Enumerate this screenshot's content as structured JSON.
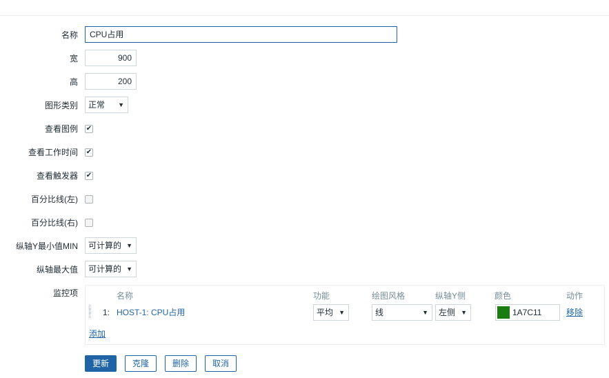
{
  "form": {
    "name_label": "名称",
    "name_value": "CPU占用",
    "width_label": "宽",
    "width_value": "900",
    "height_label": "高",
    "height_value": "200",
    "graph_type_label": "图形类别",
    "graph_type_value": "正常",
    "show_legend_label": "查看图例",
    "show_legend_checked": true,
    "show_work_period_label": "查看工作时间",
    "show_work_period_checked": true,
    "show_triggers_label": "查看触发器",
    "show_triggers_checked": true,
    "percentile_left_label": "百分比线(左)",
    "percentile_left_checked": false,
    "percentile_right_label": "百分比线(右)",
    "percentile_right_checked": false,
    "ymin_label": "纵轴Y最小值MIN",
    "ymin_value": "可计算的",
    "ymax_label": "纵轴最大值",
    "ymax_value": "可计算的",
    "items_label": "监控项"
  },
  "items_table": {
    "headers": [
      "名称",
      "功能",
      "绘图风格",
      "纵轴Y侧",
      "颜色",
      "动作"
    ],
    "rows": [
      {
        "index": "1:",
        "name": "HOST-1: CPU占用",
        "function": "平均",
        "draw_style": "线",
        "y_side": "左侧",
        "color_hex": "1A7C11",
        "color": "#1A7C11",
        "action": "移除"
      }
    ],
    "add_label": "添加"
  },
  "buttons": {
    "update": "更新",
    "clone": "克隆",
    "delete": "删除",
    "cancel": "取消"
  },
  "colors": {
    "accent": "#1f65a6",
    "swatch": "#1A7C11"
  }
}
